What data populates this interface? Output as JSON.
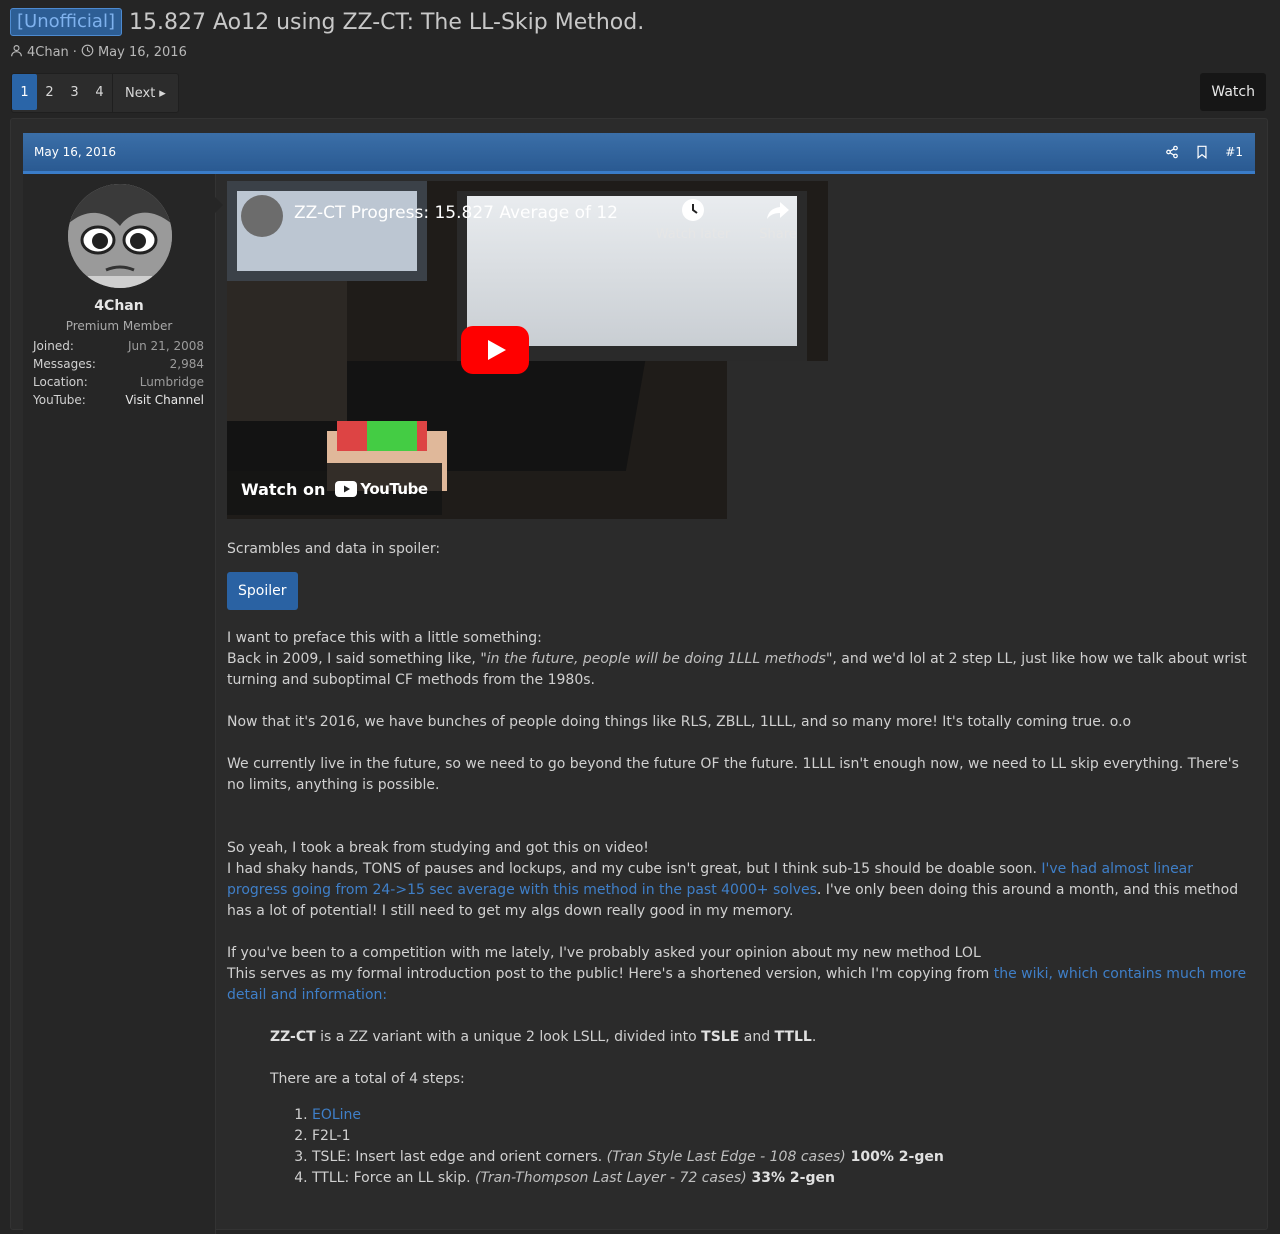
{
  "thread": {
    "prefix": "[Unofficial]",
    "title": "15.827 Ao12 using ZZ-CT: The LL-Skip Method.",
    "author": "4Chan",
    "date": "May 16, 2016"
  },
  "pager": {
    "pages": [
      "1",
      "2",
      "3",
      "4"
    ],
    "next_label": "Next",
    "watch_label": "Watch"
  },
  "post": {
    "date": "May 16, 2016",
    "number": "#1",
    "user": {
      "name": "4Chan",
      "title": "Premium Member",
      "stats": [
        {
          "key": "Joined:",
          "value": "Jun 21, 2008"
        },
        {
          "key": "Messages:",
          "value": "2,984"
        },
        {
          "key": "Location:",
          "value": "Lumbridge"
        },
        {
          "key": "YouTube:",
          "value": "Visit Channel"
        }
      ]
    },
    "video": {
      "title": "ZZ-CT Progress: 15.827 Average of 12",
      "watch_later": "Watch later",
      "share": "Share",
      "watch_on": "Watch on",
      "youtube": "YouTube"
    },
    "body": {
      "spoiler_intro": "Scrambles and data in spoiler:",
      "spoiler_label": "Spoiler",
      "p1_line1": "I want to preface this with a little something:",
      "p1_a": "Back in 2009, I said something like, \"",
      "p1_quote": "in the future, people will be doing 1LLL methods",
      "p1_b": "\", and we'd lol at 2 step LL, just like how we talk about wrist turning and suboptimal CF methods from the 1980s.",
      "p2": "Now that it's 2016, we have bunches of people doing things like RLS, ZBLL, 1LLL, and so many more! It's totally coming true. o.o",
      "p3": "We currently live in the future, so we need to go beyond the future OF the future. 1LLL isn't enough now, we need to LL skip everything. There's no limits, anything is possible.",
      "p4_line1": "So yeah, I took a break from studying and got this on video!",
      "p4_a": "I had shaky hands, TONS of pauses and lockups, and my cube isn't great, but I think sub-15 should be doable soon. ",
      "p4_link": "I've had almost linear progress going from 24->15 sec average with this method in the past 4000+ solves",
      "p4_b": ". I've only been doing this around a month, and this method has a lot of potential! I still need to get my algs down really good in my memory.",
      "p5_line1": "If you've been to a competition with me lately, I've probably asked your opinion about my new method LOL",
      "p5_a": "This serves as my formal introduction post to the public! Here's a shortened version, which I'm copying from ",
      "p5_link": "the wiki, which contains much more detail and information:",
      "q1_b1": "ZZ-CT",
      "q1_a": " is a ZZ variant with a unique 2 look LSLL, divided into ",
      "q1_b2": "TSLE",
      "q1_c": " and ",
      "q1_b3": "TTLL",
      "q1_d": ".",
      "q2": "There are a total of 4 steps:",
      "steps": [
        {
          "text": "",
          "link": "EOLine",
          "italic": "",
          "bold": ""
        },
        {
          "text": "F2L-1",
          "link": "",
          "italic": "",
          "bold": ""
        },
        {
          "text": "TSLE: Insert last edge and orient corners. ",
          "link": "",
          "italic": "(Tran Style Last Edge - 108 cases)",
          "bold": " 100% 2-gen"
        },
        {
          "text": "TTLL: Force an LL skip. ",
          "link": "",
          "italic": "(Tran-Thompson Last Layer - 72 cases)",
          "bold": " 33% 2-gen"
        }
      ]
    }
  },
  "colors": {
    "accent": "#2a65a8",
    "link": "#3f7fc8",
    "header_gradient_top": "#3b6fa8",
    "background": "#252525"
  }
}
